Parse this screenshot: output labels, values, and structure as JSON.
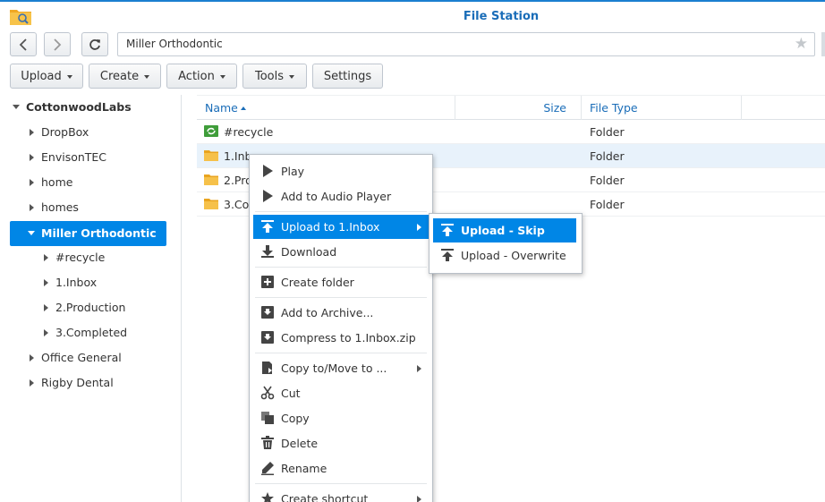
{
  "app": {
    "title": "File Station"
  },
  "nav": {
    "path": "Miller Orthodontic"
  },
  "toolbar": {
    "upload": "Upload",
    "create": "Create",
    "action": "Action",
    "tools": "Tools",
    "settings": "Settings"
  },
  "tree": {
    "root": "CottonwoodLabs",
    "items": [
      {
        "label": "DropBox"
      },
      {
        "label": "EnvisonTEC"
      },
      {
        "label": "home"
      },
      {
        "label": "homes"
      },
      {
        "label": "Miller Orthodontic"
      },
      {
        "label": "#recycle"
      },
      {
        "label": "1.Inbox"
      },
      {
        "label": "2.Production"
      },
      {
        "label": "3.Completed"
      },
      {
        "label": "Office General"
      },
      {
        "label": "Rigby Dental"
      }
    ]
  },
  "grid": {
    "headers": {
      "name": "Name",
      "size": "Size",
      "type": "File Type"
    },
    "rows": [
      {
        "name": "#recycle",
        "size": "",
        "type": "Folder",
        "icon": "recycle-folder-icon"
      },
      {
        "name": "1.Inb",
        "size": "",
        "type": "Folder",
        "icon": "folder-icon"
      },
      {
        "name": "2.Pro",
        "size": "",
        "type": "Folder",
        "icon": "folder-icon"
      },
      {
        "name": "3.Co",
        "size": "",
        "type": "Folder",
        "icon": "folder-icon"
      }
    ]
  },
  "context_menu": {
    "items": [
      {
        "label": "Play",
        "icon": "play-icon"
      },
      {
        "label": "Add to Audio Player",
        "icon": "play-icon"
      },
      {
        "label": "Upload to 1.Inbox",
        "icon": "upload-icon"
      },
      {
        "label": "Download",
        "icon": "download-icon"
      },
      {
        "label": "Create folder",
        "icon": "create-folder-icon"
      },
      {
        "label": "Add to Archive...",
        "icon": "archive-icon"
      },
      {
        "label": "Compress to 1.Inbox.zip",
        "icon": "compress-icon"
      },
      {
        "label": "Copy to/Move to ...",
        "icon": "copy-move-icon"
      },
      {
        "label": "Cut",
        "icon": "scissors-icon"
      },
      {
        "label": "Copy",
        "icon": "copy-icon"
      },
      {
        "label": "Delete",
        "icon": "trash-icon"
      },
      {
        "label": "Rename",
        "icon": "pencil-icon"
      },
      {
        "label": "Create shortcut",
        "icon": "star-icon"
      }
    ]
  },
  "submenu": {
    "items": [
      {
        "label": "Upload - Skip",
        "icon": "upload-icon"
      },
      {
        "label": "Upload - Overwrite",
        "icon": "upload-icon"
      }
    ]
  },
  "colors": {
    "accent": "#0086e6",
    "title": "#1a6db8",
    "row_highlight": "#e8f2fb"
  }
}
